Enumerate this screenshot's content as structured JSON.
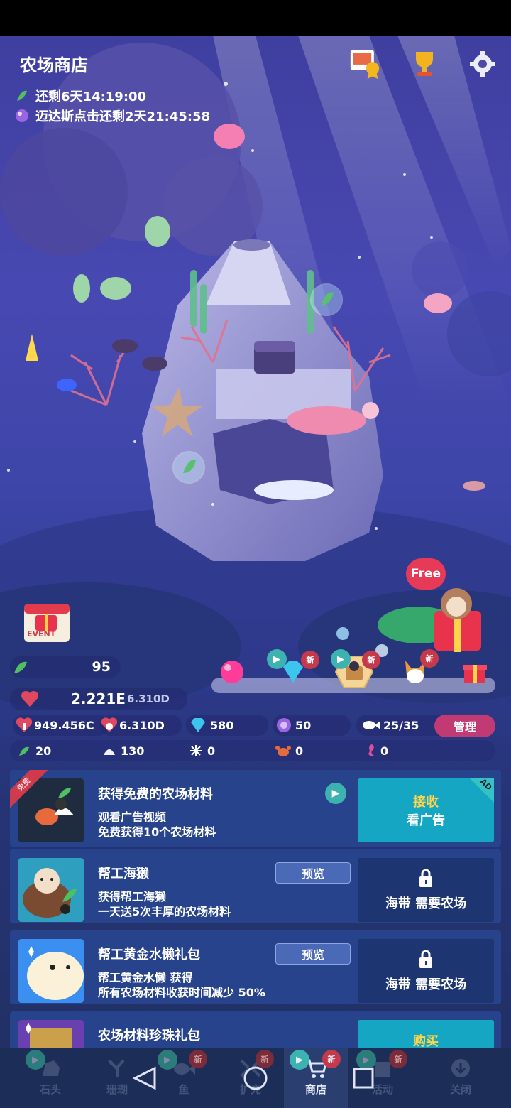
{
  "header": {
    "title": "农场商店",
    "timer1": "还剩6天14:19:00",
    "timer2": "迈达斯点击还剩2天21:45:58"
  },
  "top_icons": [
    "photo-badge-icon",
    "trophy-icon",
    "gear-icon"
  ],
  "scene": {
    "free_bubble": "Free",
    "event_label": "EVENT"
  },
  "shop_pills": [
    {
      "name": "pearl",
      "new": false,
      "play": false
    },
    {
      "name": "diamond",
      "new": true,
      "new_label": "新",
      "play": true
    },
    {
      "name": "planter",
      "new": true,
      "new_label": "新",
      "play": true
    },
    {
      "name": "corgi",
      "new": true,
      "new_label": "新",
      "play": false
    },
    {
      "name": "gift",
      "new": false,
      "play": false
    }
  ],
  "resources": {
    "leaf_count": "95",
    "hearts_main": "2.221E",
    "hearts_sub": "6.310D",
    "tap_value": "949.456C",
    "heart_rate": "6.310D",
    "diamonds": "580",
    "pearls": "50",
    "fish_capacity": "25/35",
    "manage_label": "管理",
    "materials": [
      {
        "icon": "seaweed-icon",
        "value": "20"
      },
      {
        "icon": "shell-icon",
        "value": "130"
      },
      {
        "icon": "urchin-icon",
        "value": "0"
      },
      {
        "icon": "crab-icon",
        "value": "0"
      },
      {
        "icon": "seahorse-icon",
        "value": "0"
      }
    ]
  },
  "cards": [
    {
      "ribbon": "免费",
      "title": "获得免费的农场材料",
      "desc1": "观看广告视频",
      "desc2": "免费获得10个农场材料",
      "action_line1": "接收",
      "action_line2": "看广告",
      "ad_tag": "AD"
    },
    {
      "title": "帮工海獭",
      "preview": "预览",
      "desc1": "获得帮工海獭",
      "desc2": "一天送5次丰厚的农场材料",
      "action": "海带 需要农场"
    },
    {
      "title": "帮工黄金水懒礼包",
      "preview": "预览",
      "desc1": "帮工黄金水懒 获得",
      "desc2": "所有农场材料收获时间减少 50%",
      "action": "海带 需要农场"
    },
    {
      "title": "农场材料珍珠礼包",
      "action": "购买"
    }
  ],
  "tabs": [
    {
      "label": "石头",
      "play": true,
      "new": false
    },
    {
      "label": "珊瑚",
      "play": false,
      "new": false
    },
    {
      "label": "鱼",
      "play": true,
      "new": true
    },
    {
      "label": "扩充",
      "play": false,
      "new": true
    },
    {
      "label": "商店",
      "play": true,
      "new": true,
      "active": true
    },
    {
      "label": "活动",
      "play": true,
      "new": true
    },
    {
      "label": "关闭",
      "play": false,
      "new": false
    }
  ],
  "new_label": "新"
}
